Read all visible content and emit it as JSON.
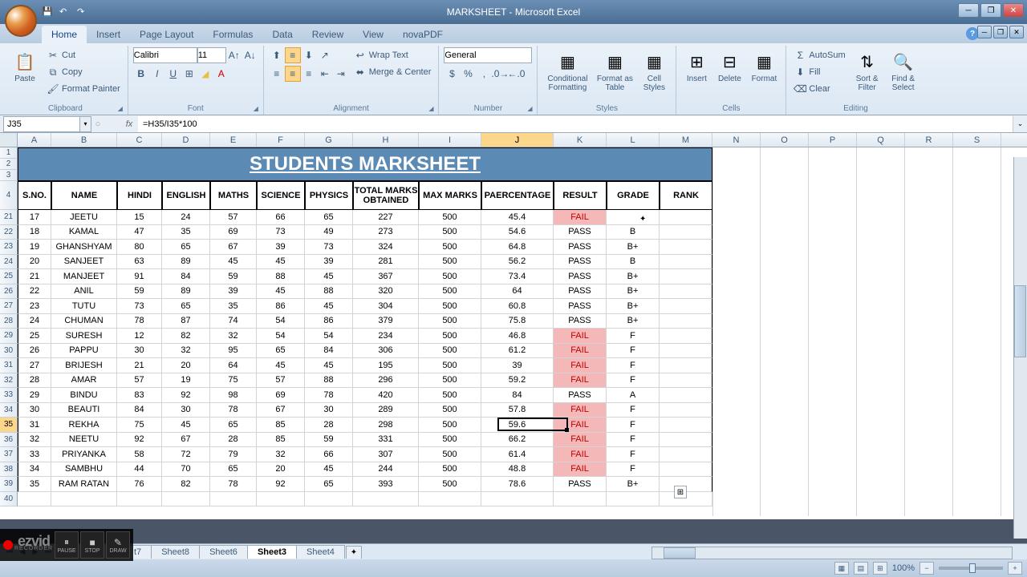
{
  "app": {
    "title": "MARKSHEET - Microsoft Excel"
  },
  "qat": {
    "save": "💾",
    "undo": "↶",
    "redo": "↷"
  },
  "tabs": [
    "Home",
    "Insert",
    "Page Layout",
    "Formulas",
    "Data",
    "Review",
    "View",
    "novaPDF"
  ],
  "active_tab": "Home",
  "ribbon": {
    "clipboard": {
      "label": "Clipboard",
      "paste": "Paste",
      "cut": "Cut",
      "copy": "Copy",
      "fp": "Format Painter"
    },
    "font": {
      "label": "Font",
      "name": "Calibri",
      "size": "11"
    },
    "alignment": {
      "label": "Alignment",
      "wrap": "Wrap Text",
      "merge": "Merge & Center"
    },
    "number": {
      "label": "Number",
      "format": "General"
    },
    "styles": {
      "label": "Styles",
      "cond": "Conditional Formatting",
      "table": "Format as Table",
      "cell": "Cell Styles"
    },
    "cells": {
      "label": "Cells",
      "insert": "Insert",
      "delete": "Delete",
      "format": "Format"
    },
    "editing": {
      "label": "Editing",
      "sum": "AutoSum",
      "fill": "Fill",
      "clear": "Clear",
      "sort": "Sort & Filter",
      "find": "Find & Select"
    }
  },
  "namebox": "J35",
  "formula": "=H35/I35*100",
  "col_letters": [
    "A",
    "B",
    "C",
    "D",
    "E",
    "F",
    "G",
    "H",
    "I",
    "J",
    "K",
    "L",
    "M",
    "N",
    "O",
    "P",
    "Q",
    "R",
    "S"
  ],
  "row_nums_top": [
    "1",
    "2",
    "3",
    "4"
  ],
  "row_nums": [
    "21",
    "22",
    "23",
    "24",
    "25",
    "26",
    "27",
    "28",
    "29",
    "30",
    "31",
    "32",
    "33",
    "34",
    "35",
    "36",
    "37",
    "38",
    "39",
    "40"
  ],
  "title_text": "STUDENTS MARKSHEET",
  "headers": [
    "S.NO.",
    "NAME",
    "HINDI",
    "ENGLISH",
    "MATHS",
    "SCIENCE",
    "PHYSICS",
    "TOTAL MARKS OBTAINED",
    "MAX MARKS",
    "PAERCENTAGE",
    "RESULT",
    "GRADE",
    "RANK"
  ],
  "rows": [
    {
      "sno": "17",
      "name": "JEETU",
      "h": "15",
      "e": "24",
      "m": "57",
      "s": "66",
      "p": "65",
      "tot": "227",
      "max": "500",
      "pct": "45.4",
      "res": "FAIL",
      "grade": ""
    },
    {
      "sno": "18",
      "name": "KAMAL",
      "h": "47",
      "e": "35",
      "m": "69",
      "s": "73",
      "p": "49",
      "tot": "273",
      "max": "500",
      "pct": "54.6",
      "res": "PASS",
      "grade": "B"
    },
    {
      "sno": "19",
      "name": "GHANSHYAM",
      "h": "80",
      "e": "65",
      "m": "67",
      "s": "39",
      "p": "73",
      "tot": "324",
      "max": "500",
      "pct": "64.8",
      "res": "PASS",
      "grade": "B+"
    },
    {
      "sno": "20",
      "name": "SANJEET",
      "h": "63",
      "e": "89",
      "m": "45",
      "s": "45",
      "p": "39",
      "tot": "281",
      "max": "500",
      "pct": "56.2",
      "res": "PASS",
      "grade": "B"
    },
    {
      "sno": "21",
      "name": "MANJEET",
      "h": "91",
      "e": "84",
      "m": "59",
      "s": "88",
      "p": "45",
      "tot": "367",
      "max": "500",
      "pct": "73.4",
      "res": "PASS",
      "grade": "B+"
    },
    {
      "sno": "22",
      "name": "ANIL",
      "h": "59",
      "e": "89",
      "m": "39",
      "s": "45",
      "p": "88",
      "tot": "320",
      "max": "500",
      "pct": "64",
      "res": "PASS",
      "grade": "B+"
    },
    {
      "sno": "23",
      "name": "TUTU",
      "h": "73",
      "e": "65",
      "m": "35",
      "s": "86",
      "p": "45",
      "tot": "304",
      "max": "500",
      "pct": "60.8",
      "res": "PASS",
      "grade": "B+"
    },
    {
      "sno": "24",
      "name": "CHUMAN",
      "h": "78",
      "e": "87",
      "m": "74",
      "s": "54",
      "p": "86",
      "tot": "379",
      "max": "500",
      "pct": "75.8",
      "res": "PASS",
      "grade": "B+"
    },
    {
      "sno": "25",
      "name": "SURESH",
      "h": "12",
      "e": "82",
      "m": "32",
      "s": "54",
      "p": "54",
      "tot": "234",
      "max": "500",
      "pct": "46.8",
      "res": "FAIL",
      "grade": "F"
    },
    {
      "sno": "26",
      "name": "PAPPU",
      "h": "30",
      "e": "32",
      "m": "95",
      "s": "65",
      "p": "84",
      "tot": "306",
      "max": "500",
      "pct": "61.2",
      "res": "FAIL",
      "grade": "F"
    },
    {
      "sno": "27",
      "name": "BRIJESH",
      "h": "21",
      "e": "20",
      "m": "64",
      "s": "45",
      "p": "45",
      "tot": "195",
      "max": "500",
      "pct": "39",
      "res": "FAIL",
      "grade": "F"
    },
    {
      "sno": "28",
      "name": "AMAR",
      "h": "57",
      "e": "19",
      "m": "75",
      "s": "57",
      "p": "88",
      "tot": "296",
      "max": "500",
      "pct": "59.2",
      "res": "FAIL",
      "grade": "F"
    },
    {
      "sno": "29",
      "name": "BINDU",
      "h": "83",
      "e": "92",
      "m": "98",
      "s": "69",
      "p": "78",
      "tot": "420",
      "max": "500",
      "pct": "84",
      "res": "PASS",
      "grade": "A"
    },
    {
      "sno": "30",
      "name": "BEAUTI",
      "h": "84",
      "e": "30",
      "m": "78",
      "s": "67",
      "p": "30",
      "tot": "289",
      "max": "500",
      "pct": "57.8",
      "res": "FAIL",
      "grade": "F"
    },
    {
      "sno": "31",
      "name": "REKHA",
      "h": "75",
      "e": "45",
      "m": "65",
      "s": "85",
      "p": "28",
      "tot": "298",
      "max": "500",
      "pct": "59.6",
      "res": "FAIL",
      "grade": "F"
    },
    {
      "sno": "32",
      "name": "NEETU",
      "h": "92",
      "e": "67",
      "m": "28",
      "s": "85",
      "p": "59",
      "tot": "331",
      "max": "500",
      "pct": "66.2",
      "res": "FAIL",
      "grade": "F"
    },
    {
      "sno": "33",
      "name": "PRIYANKA",
      "h": "58",
      "e": "72",
      "m": "79",
      "s": "32",
      "p": "66",
      "tot": "307",
      "max": "500",
      "pct": "61.4",
      "res": "FAIL",
      "grade": "F"
    },
    {
      "sno": "34",
      "name": "SAMBHU",
      "h": "44",
      "e": "70",
      "m": "65",
      "s": "20",
      "p": "45",
      "tot": "244",
      "max": "500",
      "pct": "48.8",
      "res": "FAIL",
      "grade": "F"
    },
    {
      "sno": "35",
      "name": "RAM RATAN",
      "h": "76",
      "e": "82",
      "m": "78",
      "s": "92",
      "p": "65",
      "tot": "393",
      "max": "500",
      "pct": "78.6",
      "res": "PASS",
      "grade": "B+"
    }
  ],
  "sheets": [
    "t7",
    "Sheet8",
    "Sheet6",
    "Sheet3",
    "Sheet4"
  ],
  "active_sheet": "Sheet3",
  "status": {
    "zoom": "100%"
  },
  "recorder": {
    "logo": "ezvid",
    "sub": "RECORDER",
    "pause": "PAUSE",
    "stop": "STOP",
    "draw": "DRAW"
  }
}
